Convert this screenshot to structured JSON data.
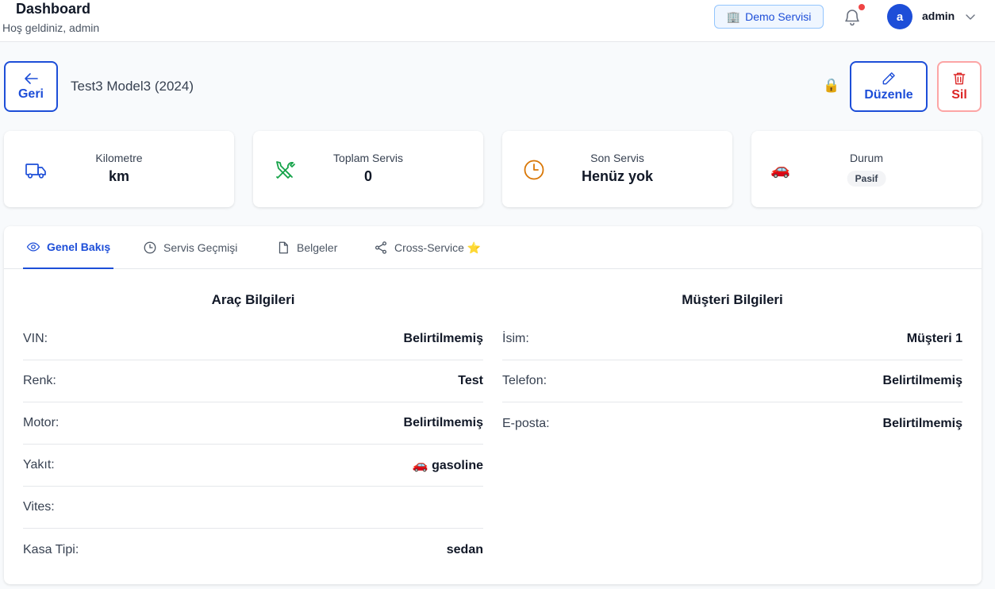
{
  "header": {
    "title": "Dashboard",
    "subtitle": "Hoş geldiniz, admin",
    "service_badge_icon": "🏢",
    "service_badge": "Demo Servisi",
    "avatar_letter": "a",
    "username": "admin"
  },
  "actions": {
    "back_label": "Geri",
    "vehicle_title": "Test3 Model3 (2024)",
    "lock_icon": "🔒",
    "edit_label": "Düzenle",
    "delete_label": "Sil"
  },
  "stats": [
    {
      "label": "Kilometre",
      "value": "km",
      "icon": "truck-icon",
      "color": "#1d4ed8"
    },
    {
      "label": "Toplam Servis",
      "value": "0",
      "icon": "tools-icon",
      "color": "#16a34a"
    },
    {
      "label": "Son Servis",
      "value": "Henüz yok",
      "icon": "clock-icon",
      "color": "#d97706"
    },
    {
      "label": "Durum",
      "value": "Pasif",
      "icon": "car-emoji",
      "emoji": "🚗"
    }
  ],
  "tabs": [
    {
      "label": "Genel Bakış",
      "icon": "eye-icon",
      "active": true
    },
    {
      "label": "Servis Geçmişi",
      "icon": "clock-icon",
      "active": false
    },
    {
      "label": "Belgeler",
      "icon": "document-icon",
      "active": false
    },
    {
      "label": "Cross-Service ⭐",
      "icon": "share-icon",
      "active": false
    }
  ],
  "vehicle_info": {
    "title": "Araç Bilgileri",
    "rows": [
      {
        "key": "VIN:",
        "value": "Belirtilmemiş"
      },
      {
        "key": "Renk:",
        "value": "Test"
      },
      {
        "key": "Motor:",
        "value": "Belirtilmemiş"
      },
      {
        "key": "Yakıt:",
        "value": "🚗 gasoline"
      },
      {
        "key": "Vites:",
        "value": ""
      },
      {
        "key": "Kasa Tipi:",
        "value": "sedan"
      }
    ]
  },
  "customer_info": {
    "title": "Müşteri Bilgileri",
    "rows": [
      {
        "key": "İsim:",
        "value": "Müşteri 1"
      },
      {
        "key": "Telefon:",
        "value": "Belirtilmemiş"
      },
      {
        "key": "E-posta:",
        "value": "Belirtilmemiş"
      }
    ]
  },
  "colors": {
    "accent": "#1d4ed8",
    "danger": "#dc2626",
    "notification_dot": "#ef4444"
  }
}
